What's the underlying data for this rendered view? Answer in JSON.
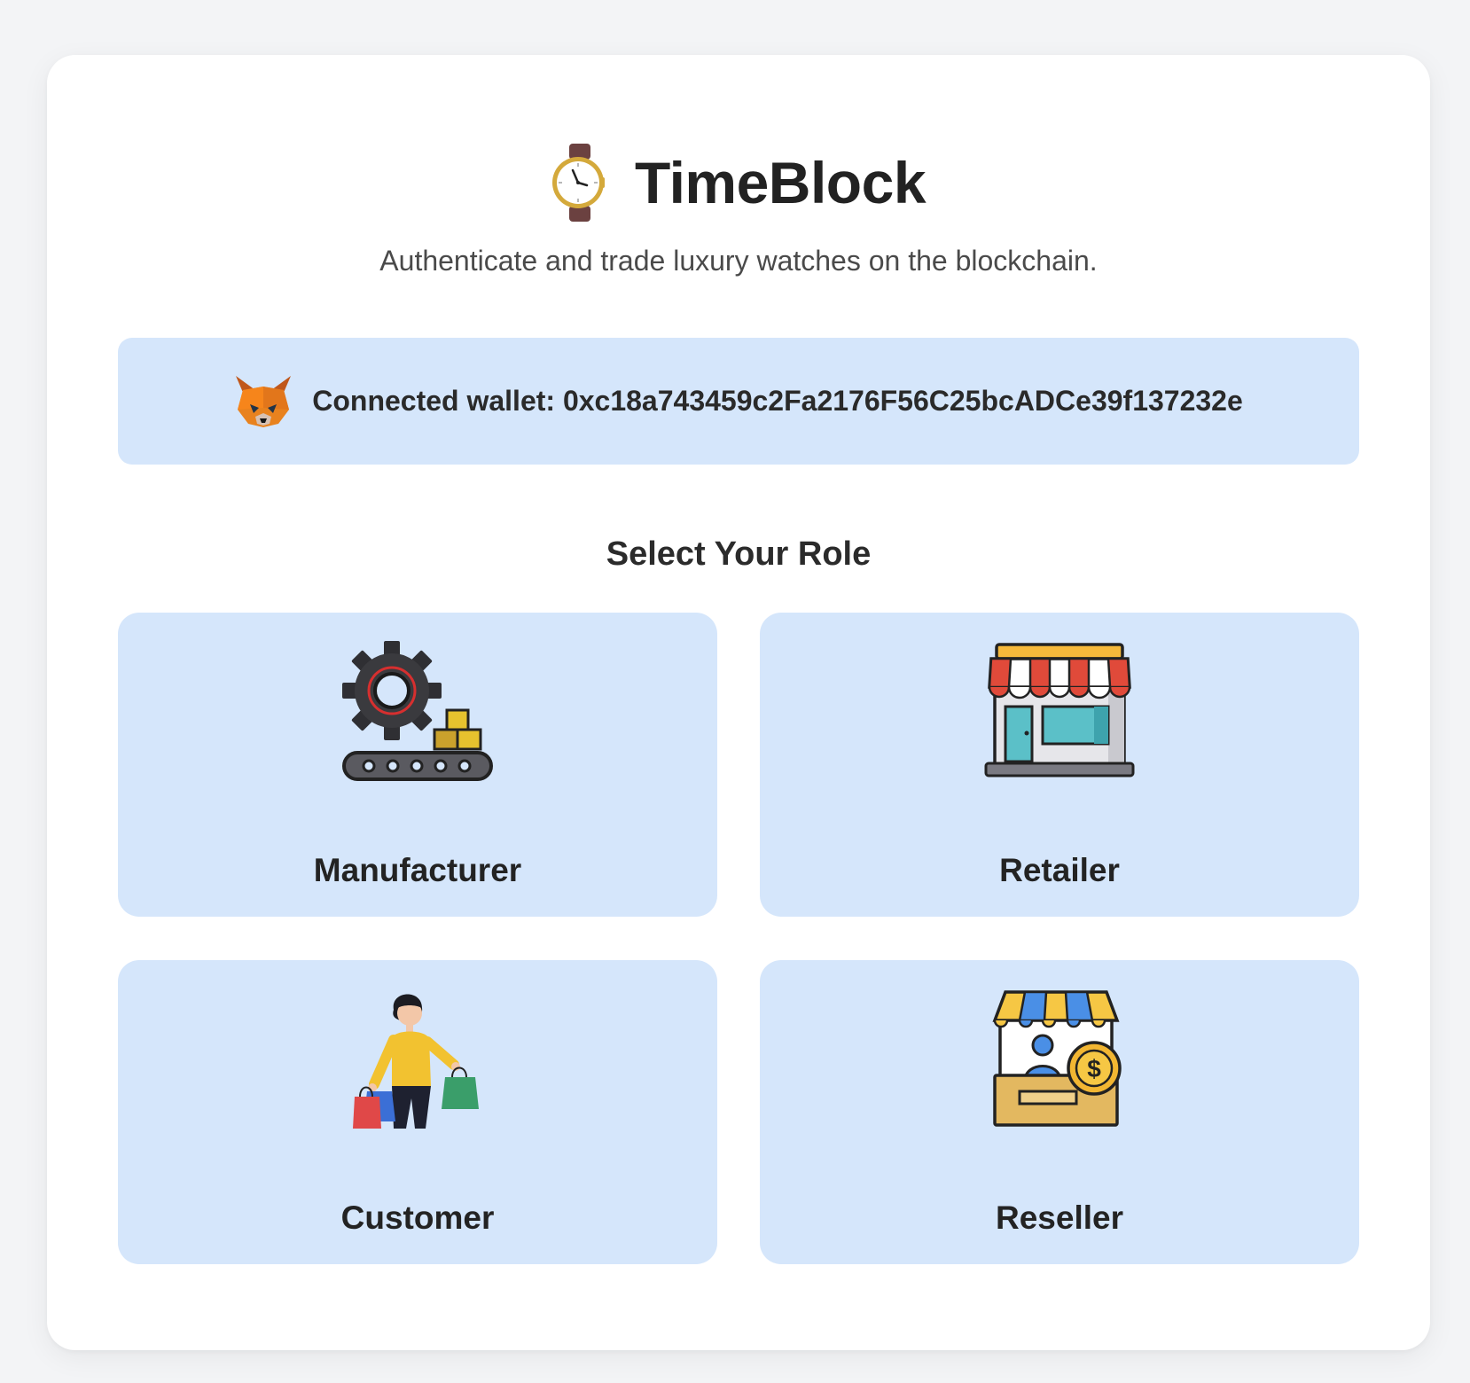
{
  "app": {
    "title": "TimeBlock",
    "tagline": "Authenticate and trade luxury watches on the blockchain.",
    "logo_icon": "wristwatch-icon"
  },
  "wallet": {
    "label": "Connected wallet: 0xc18a743459c2Fa2176F56C25bcADCe39f137232e",
    "icon": "metamask-fox-icon"
  },
  "roles": {
    "heading": "Select Your Role",
    "items": [
      {
        "label": "Manufacturer",
        "icon": "factory-conveyor-icon"
      },
      {
        "label": "Retailer",
        "icon": "storefront-icon"
      },
      {
        "label": "Customer",
        "icon": "shopper-icon"
      },
      {
        "label": "Reseller",
        "icon": "reseller-booth-icon"
      }
    ]
  },
  "colors": {
    "page_background": "#f3f4f6",
    "card_background": "#ffffff",
    "tile_background": "#d5e6fb"
  }
}
